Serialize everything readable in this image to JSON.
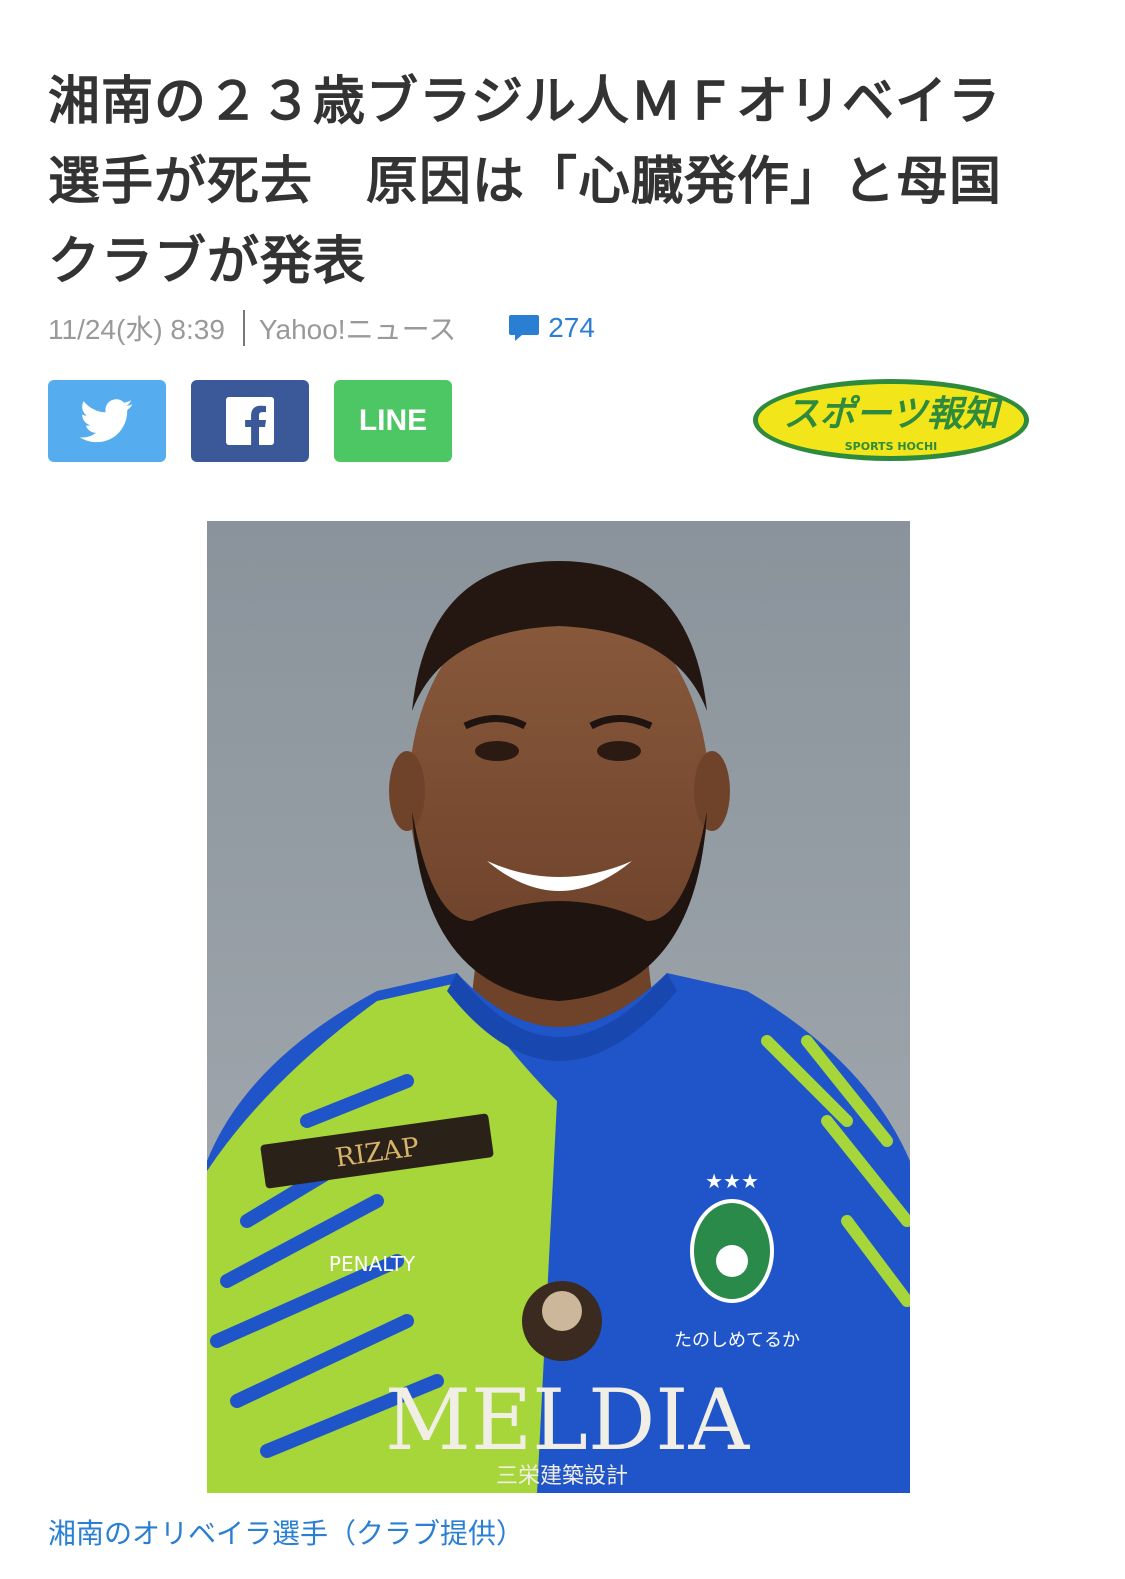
{
  "article": {
    "headline_lines": [
      "湘南の２３歳ブラジル人ＭＦオリベイラ",
      "選手が死去　原因は「心臓発作」と母国",
      "クラブが発表"
    ],
    "date": "11/24(水) 8:39",
    "source": "Yahoo!ニュース",
    "comment_count": "274"
  },
  "share": {
    "twitter_icon": "twitter-bird-icon",
    "facebook_icon": "facebook-f-icon",
    "line_label": "LINE"
  },
  "publisher_logo": {
    "main_text": "スポーツ報知",
    "sub_text": "SPORTS HOCHI"
  },
  "photo": {
    "jersey_sponsor": "RIZAP",
    "jersey_brand": "PENALTY",
    "jersey_main_sponsor": "MELDIA",
    "jersey_sub_sponsor": "三栄建築設計",
    "jersey_slogan": "たのしめてるか"
  },
  "caption": "湘南のオリベイラ選手（クラブ提供）",
  "colors": {
    "link_blue": "#2a7fd3",
    "twitter": "#55acee",
    "facebook": "#3b5998",
    "line": "#4cc764",
    "logo_yellow": "#f2e61b",
    "logo_green": "#2e8b3d"
  }
}
